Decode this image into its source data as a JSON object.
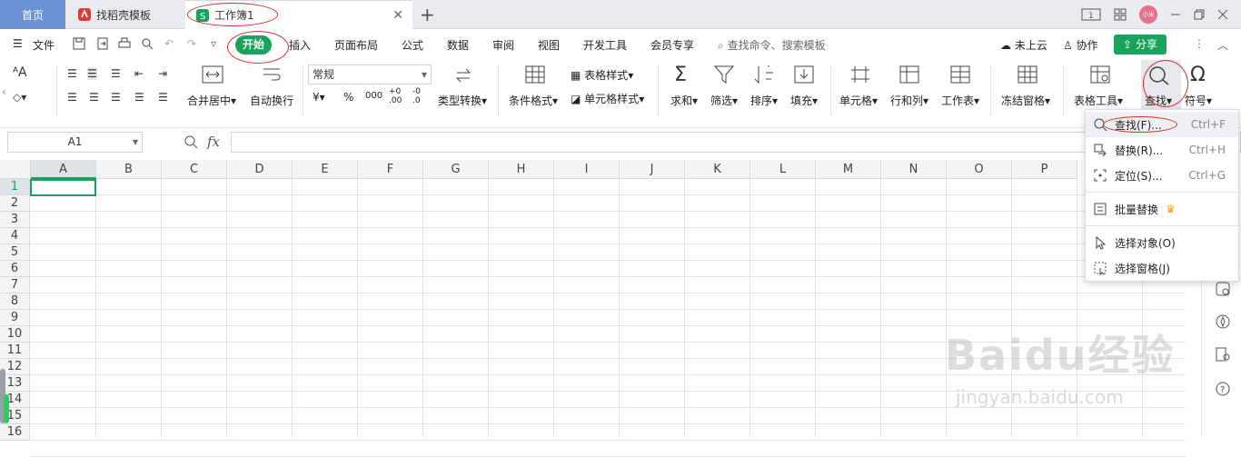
{
  "tabs": {
    "home": "首页",
    "daoke": "找稻壳模板",
    "sheet": "工作簿1"
  },
  "window": {
    "avatar_text": "小米"
  },
  "menu": {
    "file": "文件",
    "start": "开始",
    "items": [
      "插入",
      "页面布局",
      "公式",
      "数据",
      "审阅",
      "视图",
      "开发工具",
      "会员专享"
    ],
    "search": "查找命令、搜索模板",
    "cloud": "未上云",
    "collab": "协作",
    "share": "分享"
  },
  "ribbon": {
    "merge": "合并居中",
    "wrap": "自动换行",
    "format_select": "常规",
    "currency": "¥",
    "percent": "%",
    "thousands": "000",
    "dec_inc": "+0 .00",
    "dec_dec": "-0 .0",
    "type_convert": "类型转换",
    "cond_format": "条件格式",
    "table_style": "表格样式",
    "cell_style": "单元格样式",
    "sum": "求和",
    "filter": "筛选",
    "sort": "排序",
    "fill": "填充",
    "cell": "单元格",
    "rowcol": "行和列",
    "worksheet": "工作表",
    "freeze": "冻结窗格",
    "table_tools": "表格工具",
    "find": "查找",
    "symbol": "符号"
  },
  "formula": {
    "namebox": "A1",
    "fx": "fx"
  },
  "grid": {
    "columns": [
      "A",
      "B",
      "C",
      "D",
      "E",
      "F",
      "G",
      "H",
      "I",
      "J",
      "K",
      "L",
      "M",
      "N",
      "O",
      "P"
    ],
    "rows": [
      "1",
      "2",
      "3",
      "4",
      "5",
      "6",
      "7",
      "8",
      "9",
      "10",
      "11",
      "12",
      "13",
      "14",
      "15",
      "16"
    ]
  },
  "dropdown": {
    "find": {
      "label": "查找(F)...",
      "shortcut": "Ctrl+F"
    },
    "replace": {
      "label": "替换(R)...",
      "shortcut": "Ctrl+H"
    },
    "goto": {
      "label": "定位(S)...",
      "shortcut": "Ctrl+G"
    },
    "batch_replace": {
      "label": "批量替换"
    },
    "select_objects": {
      "label": "选择对象(O)"
    },
    "select_pane": {
      "label": "选择窗格(J)"
    }
  },
  "watermark": {
    "main": "Baidu经验",
    "sub": "jingyan.baidu.com"
  },
  "colors": {
    "accent": "#17a35c",
    "home_tab": "#6c93d6",
    "annotation": "#d03030"
  }
}
